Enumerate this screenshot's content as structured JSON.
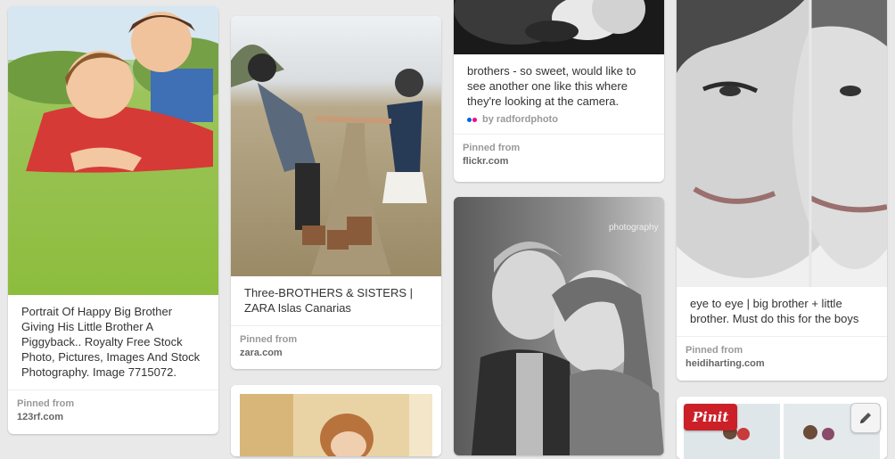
{
  "pins": [
    {
      "caption": "Portrait Of Happy Big Brother Giving His Little Brother A Piggyback.. Royalty Free Stock Photo, Pictures, Images And Stock Photography. Image 7715072.",
      "pinned_from_label": "Pinned from",
      "domain": "123rf.com",
      "image_icon": "boys-piggyback-photo"
    },
    {
      "caption": "Three-BROTHERS & SISTERS | ZARA Islas Canarias",
      "pinned_from_label": "Pinned from",
      "domain": "zara.com",
      "image_icon": "children-holding-hands-photo"
    },
    {
      "caption": "brothers - so sweet, would like to see another one like this where they're looking at the camera.",
      "credit": "by radfordphoto",
      "pinned_from_label": "Pinned from",
      "domain": "flickr.com",
      "image_icon": "black-white-hands-photo"
    },
    {
      "image_icon": "black-white-siblings-photo",
      "watermark": "photography"
    },
    {
      "caption": "eye to eye | big brother + little brother. Must do this for the boys",
      "pinned_from_label": "Pinned from",
      "domain": "heidiharting.com",
      "image_icon": "eye-to-eye-photo"
    }
  ],
  "pinit_button": "Pinit",
  "colors": {
    "pin_red": "#cb2027",
    "background": "#e9e9e9",
    "flickr_blue": "#0063dc",
    "flickr_pink": "#ff0084"
  }
}
